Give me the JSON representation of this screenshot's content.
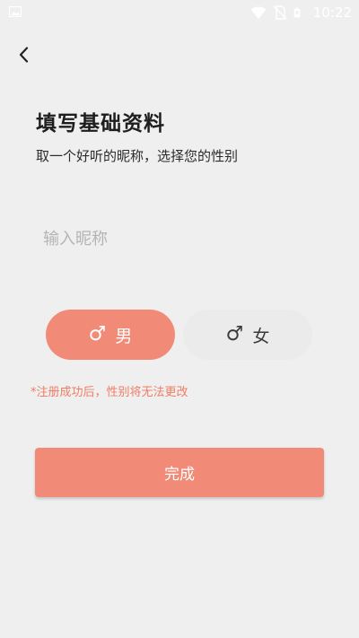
{
  "status_bar": {
    "time": "10:22",
    "icons": [
      "image-icon",
      "wifi-icon",
      "no-sim-icon",
      "battery-icon"
    ]
  },
  "header": {
    "back_icon": "chevron-left-icon"
  },
  "main": {
    "title": "填写基础资料",
    "subtitle": "取一个好听的昵称，选择您的性别",
    "nickname_placeholder": "输入昵称",
    "nickname_value": "",
    "gender": {
      "male_symbol": "♂",
      "male_label": "男",
      "female_symbol": "♂",
      "female_label": "女",
      "selected": "male"
    },
    "note": "*注册成功后，性别将无法更改",
    "submit_label": "完成"
  },
  "colors": {
    "accent": "#f18b78",
    "note": "#ef7c66",
    "background": "#efefef"
  }
}
